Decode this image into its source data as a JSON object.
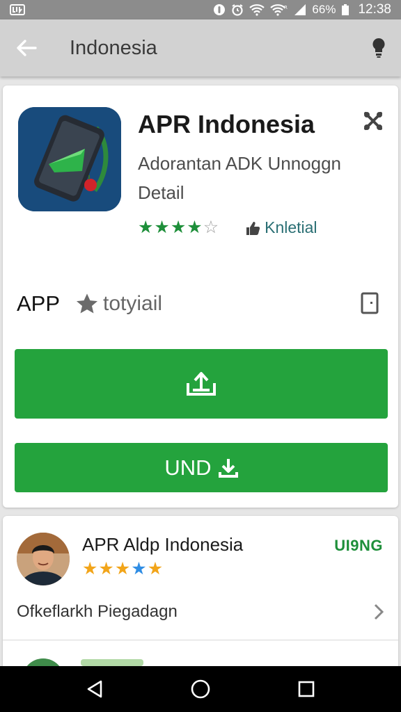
{
  "status_bar": {
    "carrier_glyph": "ш",
    "battery_text": "66%",
    "time": "12:38"
  },
  "app_bar": {
    "title": "Indonesia",
    "back_icon": "arrow-left-icon",
    "action_icon": "lightbulb-icon"
  },
  "app": {
    "name": "APR Indonesia",
    "subtitle": "Adorantan ADK Unnoggn Detail",
    "rating_stars": 4,
    "rating_max": 5,
    "verified_label": "Knletial",
    "share_icon": "share-icon"
  },
  "app_row": {
    "label": "APP",
    "star_label": "totyiail",
    "tablet_icon": "tablet-icon"
  },
  "buttons": {
    "upload_icon": "upload-icon",
    "und_label": "UND",
    "download_icon": "download-icon"
  },
  "review": {
    "title": "APR Aldp Indonesia",
    "badge": "UI9NG",
    "stars": 5,
    "link_label": "Ofkeflarkh Piegadagn",
    "chevron_icon": "chevron-right-icon"
  },
  "nav_bar": {
    "back_icon": "triangle-back-icon",
    "home_icon": "circle-home-icon",
    "recents_icon": "square-recents-icon"
  },
  "colors": {
    "accent_green": "#24a33d",
    "star_green": "#1e8f3a",
    "star_orange": "#f2a51a",
    "star_blue": "#2f8de4",
    "app_bar": "#d2d2d2",
    "status_bar": "#8c8c8c"
  }
}
